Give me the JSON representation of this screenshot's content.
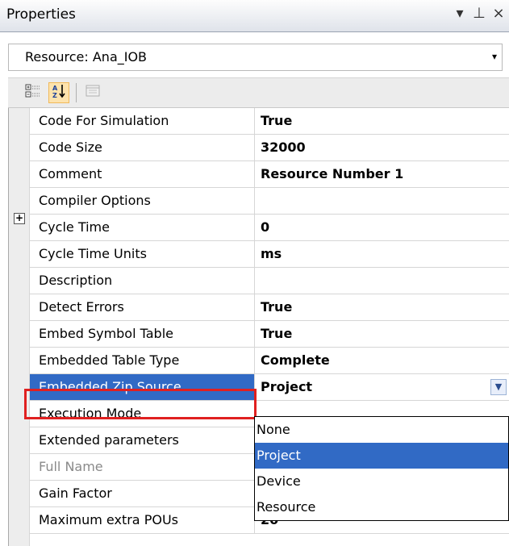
{
  "panel": {
    "title": "Properties",
    "controls": [
      "▾",
      "⊥",
      "×"
    ]
  },
  "selector": {
    "value": "Resource: Ana_IOB",
    "arrow": "▾"
  },
  "toolbar": {
    "buttons": [
      {
        "name": "categorized",
        "icon": "categorized-icon"
      },
      {
        "name": "alphabetical",
        "icon": "sort-az-icon",
        "active": true
      },
      {
        "name": "property-pages",
        "icon": "property-pages-icon"
      }
    ]
  },
  "properties": [
    {
      "name": "Code For Simulation",
      "value": "True"
    },
    {
      "name": "Code Size",
      "value": "32000"
    },
    {
      "name": "Comment",
      "value": "Resource Number 1"
    },
    {
      "name": "Compiler Options",
      "value": "",
      "expander": "+"
    },
    {
      "name": "Cycle Time",
      "value": "0"
    },
    {
      "name": "Cycle Time Units",
      "value": "ms"
    },
    {
      "name": "Description",
      "value": ""
    },
    {
      "name": "Detect Errors",
      "value": "True"
    },
    {
      "name": "Embed Symbol Table",
      "value": "True"
    },
    {
      "name": "Embedded Table Type",
      "value": "Complete"
    },
    {
      "name": "Embedded Zip Source",
      "value": "Project",
      "selected": true
    },
    {
      "name": "Execution Mode",
      "value": ""
    },
    {
      "name": "Extended parameters",
      "value": ""
    },
    {
      "name": "Full Name",
      "value": "",
      "disabled": true
    },
    {
      "name": "Gain Factor",
      "value": ""
    },
    {
      "name": "Maximum extra POUs",
      "value": "20"
    }
  ],
  "dropdown": {
    "options": [
      "None",
      "Project",
      "Device",
      "Resource"
    ],
    "selected_index": 1
  },
  "colors": {
    "selection": "#316ac5",
    "highlight": "#e02020"
  }
}
